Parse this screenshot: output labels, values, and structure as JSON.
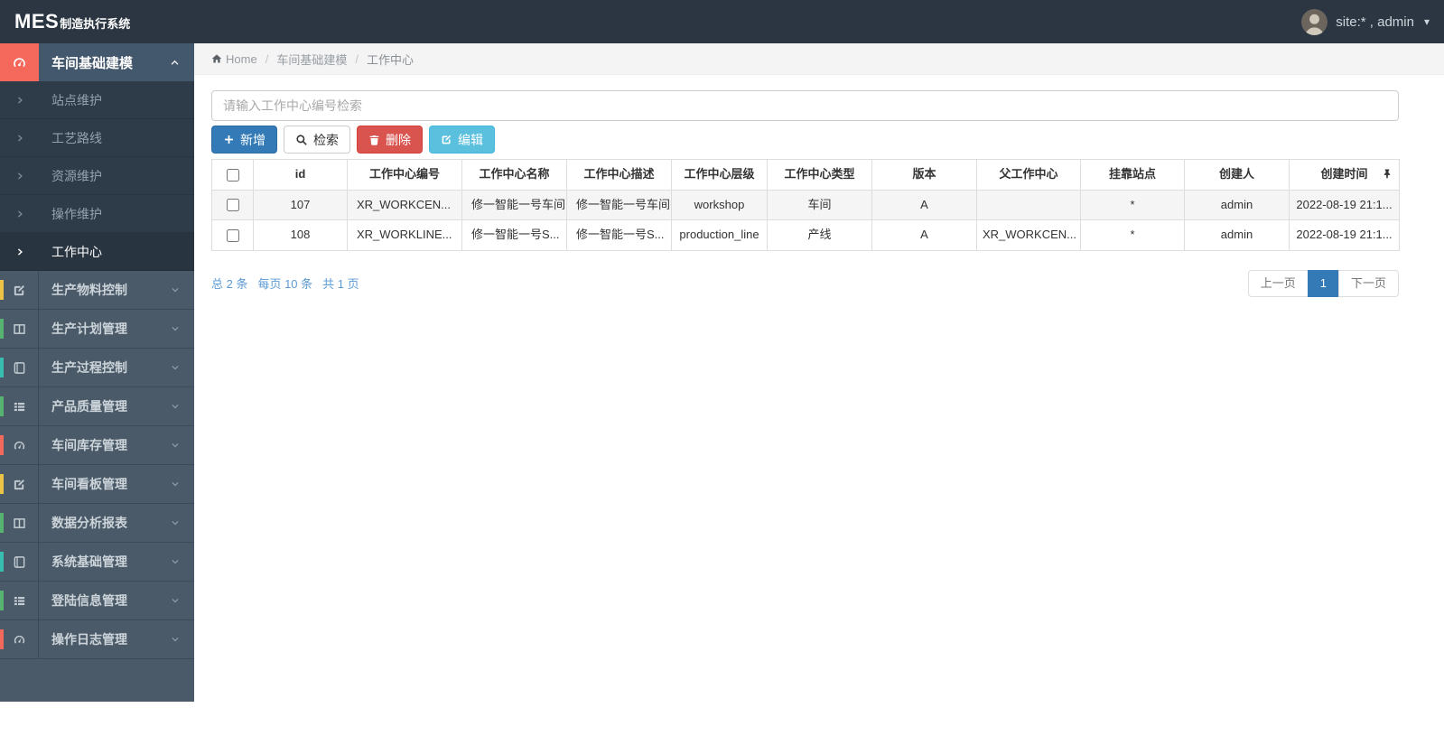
{
  "navbar": {
    "brand_bold": "MES",
    "brand_rest": "制造执行系统",
    "user_label": "site:* , admin"
  },
  "breadcrumb": {
    "home": "Home",
    "separator": "/",
    "crumbs": [
      "车间基础建模",
      "工作中心"
    ]
  },
  "sidebar": {
    "root": {
      "label": "车间基础建模"
    },
    "sub_items": [
      {
        "label": "站点维护"
      },
      {
        "label": "工艺路线"
      },
      {
        "label": "资源维护"
      },
      {
        "label": "操作维护"
      },
      {
        "label": "工作中心",
        "active": true
      }
    ],
    "items": [
      {
        "label": "生产物料控制"
      },
      {
        "label": "生产计划管理"
      },
      {
        "label": "生产过程控制"
      },
      {
        "label": "产品质量管理"
      },
      {
        "label": "车间库存管理"
      },
      {
        "label": "车间看板管理"
      },
      {
        "label": "数据分析报表"
      },
      {
        "label": "系统基础管理"
      },
      {
        "label": "登陆信息管理"
      },
      {
        "label": "操作日志管理"
      }
    ]
  },
  "search": {
    "placeholder": "请输入工作中心编号检索"
  },
  "toolbar": {
    "add": "新增",
    "search": "检索",
    "delete": "删除",
    "edit": "编辑"
  },
  "table": {
    "columns": [
      "id",
      "工作中心编号",
      "工作中心名称",
      "工作中心描述",
      "工作中心层级",
      "工作中心类型",
      "版本",
      "父工作中心",
      "挂靠站点",
      "创建人",
      "创建时间"
    ],
    "rows": [
      {
        "cells": [
          "107",
          "XR_WORKCEN...",
          "修一智能一号车间",
          "修一智能一号车间",
          "workshop",
          "车间",
          "A",
          "",
          "*",
          "admin",
          "2022-08-19 21:1..."
        ]
      },
      {
        "cells": [
          "108",
          "XR_WORKLINE...",
          "修一智能一号S...",
          "修一智能一号S...",
          "production_line",
          "产线",
          "A",
          "XR_WORKCEN...",
          "*",
          "admin",
          "2022-08-19 21:1..."
        ]
      }
    ]
  },
  "pagination": {
    "total": "总 2 条",
    "per_page": "每页 10 条",
    "pages": "共 1 页",
    "prev": "上一页",
    "current": "1",
    "next": "下一页"
  },
  "icons": {
    "caret_down": "▾",
    "caret_up": "ᐱ"
  },
  "colors": {
    "accent_blue": "#337ab7",
    "danger_red": "#d9534f",
    "info_blue": "#5bc0de",
    "brand_salmon": "#f4695c",
    "strip_yellow": "#ecc344",
    "strip_green": "#56b470",
    "strip_teal": "#3abdb1",
    "summary_blue": "#5b9bd5"
  }
}
